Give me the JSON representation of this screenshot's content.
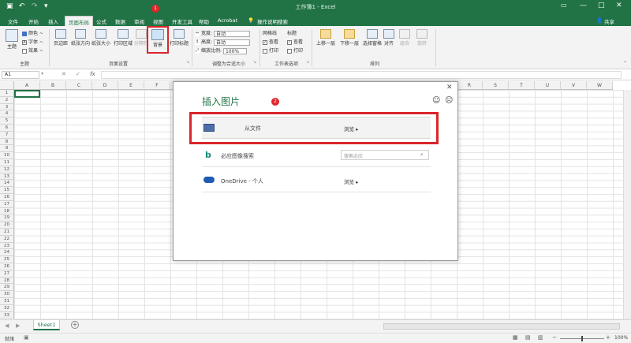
{
  "window": {
    "title": "工作簿1 - Excel"
  },
  "tabs": [
    {
      "label": "文件"
    },
    {
      "label": "开始"
    },
    {
      "label": "插入"
    },
    {
      "label": "页面布局"
    },
    {
      "label": "公式"
    },
    {
      "label": "数据"
    },
    {
      "label": "审阅"
    },
    {
      "label": "视图"
    },
    {
      "label": "开发工具"
    },
    {
      "label": "帮助"
    },
    {
      "label": "Acrobat"
    },
    {
      "label": "操作说明搜索"
    }
  ],
  "share_label": "共享",
  "ribbon": {
    "themes": {
      "label": "主题",
      "btn_theme": "主题",
      "colors": "颜色 ~",
      "fonts": "字体 ~",
      "effects": "效果 ~"
    },
    "page_setup": {
      "label": "页面设置",
      "margins": "页边距",
      "orientation": "纸张方向",
      "size": "纸张大小",
      "print_area": "打印区域",
      "breaks": "分隔符",
      "background": "背景",
      "print_titles": "打印标题"
    },
    "scale": {
      "label": "调整为合适大小",
      "width_label": "宽度:",
      "width_value": "自动",
      "height_label": "高度:",
      "height_value": "自动",
      "scale_label": "缩放比例:",
      "scale_value": "100%"
    },
    "sheet_options": {
      "label": "工作表选项",
      "gridlines": "网格线",
      "headings": "标题",
      "view": "查看",
      "print": "打印"
    },
    "arrange": {
      "label": "排列",
      "forward": "上移一层",
      "backward": "下移一层",
      "selection_pane": "选择窗格",
      "align": "对齐",
      "group": "组合",
      "rotate": "旋转"
    }
  },
  "formula_bar": {
    "cell_ref": "A1",
    "fx": "fx"
  },
  "columns": [
    "A",
    "B",
    "C",
    "D",
    "E",
    "F",
    "G",
    "H",
    "I",
    "J",
    "K",
    "L",
    "M",
    "N",
    "O",
    "P",
    "Q",
    "R",
    "S",
    "T",
    "U",
    "V",
    "W"
  ],
  "rows": [
    "1",
    "2",
    "3",
    "4",
    "5",
    "6",
    "7",
    "8",
    "9",
    "10",
    "11",
    "12",
    "13",
    "14",
    "15",
    "16",
    "17",
    "18",
    "19",
    "20",
    "21",
    "22",
    "23",
    "24",
    "25",
    "26",
    "27",
    "28",
    "29",
    "30",
    "31",
    "32",
    "33"
  ],
  "dialog": {
    "title": "插入图片",
    "options": [
      {
        "label": "从文件",
        "action": "浏览 ▸"
      },
      {
        "label": "必应图像搜索",
        "placeholder": "搜索必应"
      },
      {
        "label": "OneDrive - 个人",
        "action": "浏览 ▸"
      }
    ]
  },
  "annotations": {
    "badge1": "1",
    "badge2": "2"
  },
  "sheet_tab": "Sheet1",
  "status": {
    "left": "就绪",
    "zoom": "100%"
  }
}
